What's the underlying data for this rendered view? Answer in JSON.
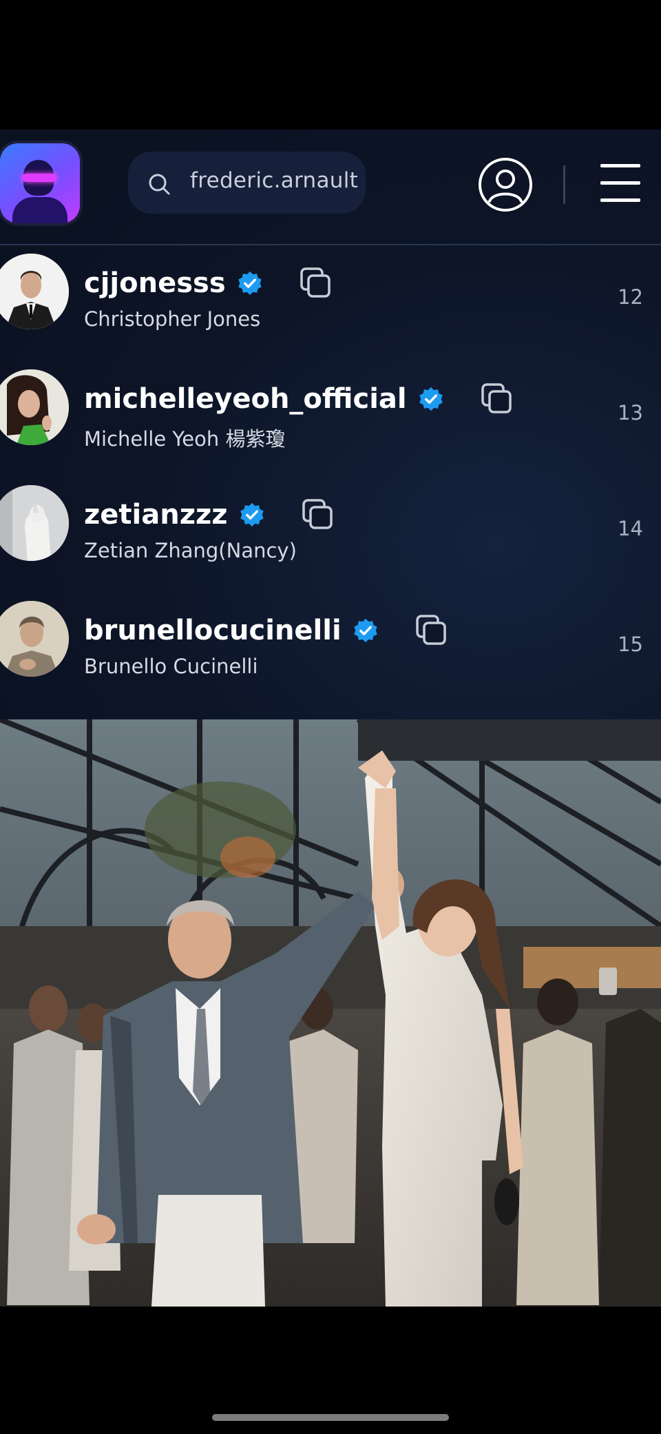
{
  "search": {
    "query": "frederic.arnault"
  },
  "results": [
    {
      "handle": "cjjonesss",
      "full_name": "Christopher Jones",
      "rank": "12"
    },
    {
      "handle": "michelleyeoh_official",
      "full_name": "Michelle Yeoh 楊紫瓊",
      "rank": "13"
    },
    {
      "handle": "zetianzzz",
      "full_name": "Zetian Zhang(Nancy)",
      "rank": "14"
    },
    {
      "handle": "brunellocucinelli",
      "full_name": "Brunello Cucinelli",
      "rank": "15"
    }
  ],
  "colors": {
    "panel_bg": "#0c1426",
    "verified_blue": "#1d9bf0",
    "search_bg": "#17203a"
  },
  "icons": [
    "app-logo-icon",
    "search-icon",
    "profile-icon",
    "menu-icon",
    "verified-badge-icon",
    "copy-icon"
  ]
}
